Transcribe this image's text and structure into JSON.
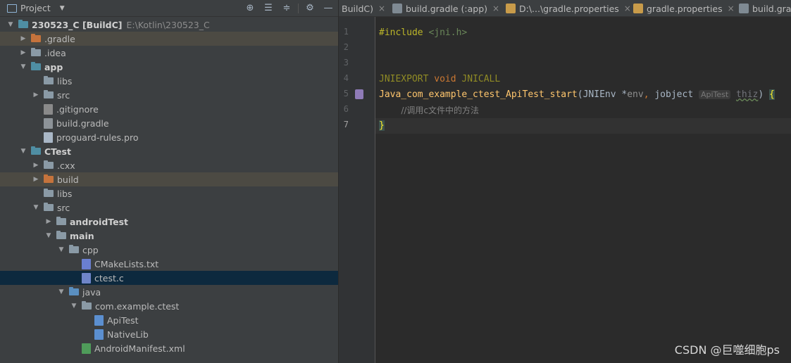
{
  "project_panel": {
    "title": "Project",
    "header_icons": [
      "locate-icon",
      "expand-all-icon",
      "collapse-all-icon",
      "gear-icon",
      "minimize-icon"
    ]
  },
  "tree": [
    {
      "label": "230523_C [BuildC]",
      "extra": "E:\\Kotlin\\230523_C",
      "depth": 0,
      "arrow": "down",
      "icon": "module",
      "bold": true
    },
    {
      "label": ".gradle",
      "depth": 1,
      "arrow": "right",
      "icon": "folder-orange",
      "highlight": true
    },
    {
      "label": ".idea",
      "depth": 1,
      "arrow": "right",
      "icon": "folder-grey"
    },
    {
      "label": "app",
      "depth": 1,
      "arrow": "down",
      "icon": "module",
      "bold": true
    },
    {
      "label": "libs",
      "depth": 2,
      "arrow": "",
      "icon": "folder-grey"
    },
    {
      "label": "src",
      "depth": 2,
      "arrow": "right",
      "icon": "folder-grey"
    },
    {
      "label": ".gitignore",
      "depth": 2,
      "arrow": "",
      "icon": "file-gitignore"
    },
    {
      "label": "build.gradle",
      "depth": 2,
      "arrow": "",
      "icon": "file-gradle"
    },
    {
      "label": "proguard-rules.pro",
      "depth": 2,
      "arrow": "",
      "icon": "file-text"
    },
    {
      "label": "CTest",
      "depth": 1,
      "arrow": "down",
      "icon": "module",
      "bold": true
    },
    {
      "label": ".cxx",
      "depth": 2,
      "arrow": "right",
      "icon": "folder-grey"
    },
    {
      "label": "build",
      "depth": 2,
      "arrow": "right",
      "icon": "folder-orange",
      "highlight": true
    },
    {
      "label": "libs",
      "depth": 2,
      "arrow": "",
      "icon": "folder-grey"
    },
    {
      "label": "src",
      "depth": 2,
      "arrow": "down",
      "icon": "folder-grey"
    },
    {
      "label": "androidTest",
      "depth": 3,
      "arrow": "right",
      "icon": "folder-grey",
      "bold": true
    },
    {
      "label": "main",
      "depth": 3,
      "arrow": "down",
      "icon": "folder-grey",
      "bold": true
    },
    {
      "label": "cpp",
      "depth": 4,
      "arrow": "down",
      "icon": "folder-grey"
    },
    {
      "label": "CMakeLists.txt",
      "depth": 5,
      "arrow": "",
      "icon": "file-cmake"
    },
    {
      "label": "ctest.c",
      "depth": 5,
      "arrow": "",
      "icon": "file-c",
      "selected": true
    },
    {
      "label": "java",
      "depth": 4,
      "arrow": "down",
      "icon": "folder-blue"
    },
    {
      "label": "com.example.ctest",
      "depth": 5,
      "arrow": "down",
      "icon": "package"
    },
    {
      "label": "ApiTest",
      "depth": 6,
      "arrow": "",
      "icon": "file-kotlin"
    },
    {
      "label": "NativeLib",
      "depth": 6,
      "arrow": "",
      "icon": "file-kotlin"
    },
    {
      "label": "AndroidManifest.xml",
      "depth": 5,
      "arrow": "",
      "icon": "file-xml"
    }
  ],
  "tabs": [
    {
      "label": "BuildC)",
      "icon": ""
    },
    {
      "label": "build.gradle (:app)",
      "icon": "gradle-icon"
    },
    {
      "label": "D:\\...\\gradle.properties",
      "icon": "properties-icon"
    },
    {
      "label": "gradle.properties",
      "icon": "properties-icon"
    },
    {
      "label": "build.gra",
      "icon": "gradle-icon"
    }
  ],
  "editor": {
    "line_numbers": [
      "1",
      "2",
      "3",
      "4",
      "5",
      "6",
      "7"
    ],
    "current_line": "7",
    "code": {
      "l1_directive": "#include",
      "l1_header": "<jni.h>",
      "l4_export": "JNIEXPORT",
      "l4_void": "void",
      "l4_call": "JNICALL",
      "l5_fn": "Java_com_example_ctest_ApiTest_start",
      "l5_open": "(",
      "l5_type1": "JNIEnv",
      "l5_star": " *",
      "l5_param1": "env",
      "l5_comma": ", ",
      "l5_type2": "jobject",
      "l5_hint": "ApiTest",
      "l5_param2": "thiz",
      "l5_close": ")",
      "l5_brace": "{",
      "l6_comment": "//调用c文件中的方法",
      "l7_brace": "}"
    }
  },
  "watermark": "CSDN @巨噬细胞ps",
  "colors": {
    "panel_bg": "#3c3f41",
    "editor_bg": "#2b2b2b",
    "selected_row": "#0d293e",
    "highlight_row": "#4c4a43"
  }
}
